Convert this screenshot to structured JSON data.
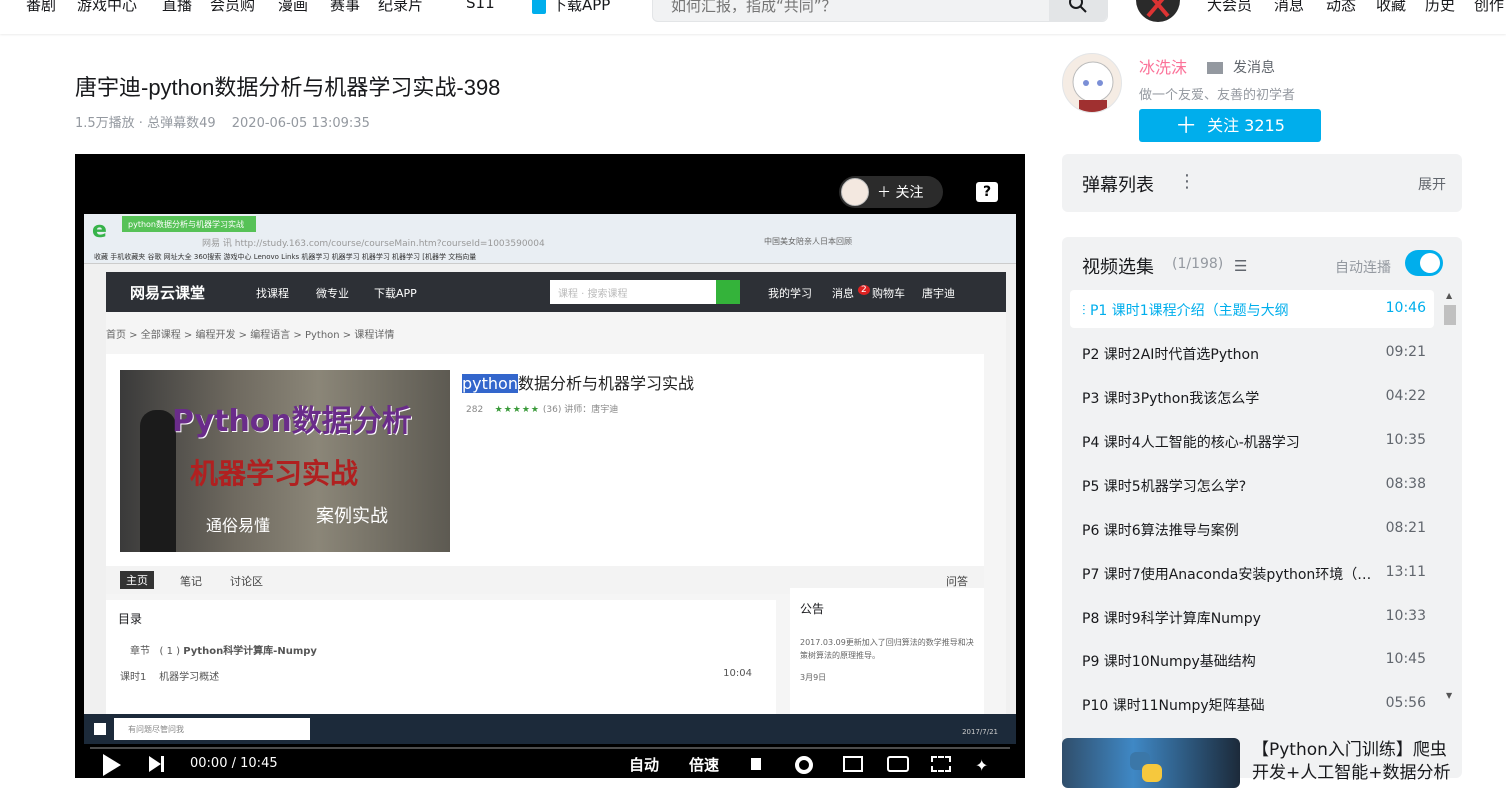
{
  "nav": {
    "items": [
      "番剧",
      "游戏中心",
      "直播",
      "会员购",
      "漫画",
      "赛事",
      "纪录片",
      "S11",
      "下载APP"
    ],
    "search_placeholder": "如何汇报，指成“共同”？",
    "right": [
      "大会员",
      "消息",
      "动态",
      "收藏",
      "历史",
      "创作"
    ]
  },
  "video": {
    "title": "唐宇迪-python数据分析与机器学习实战-398",
    "plays": "1.5万播放 · 总弹幕数49",
    "date": "2020-06-05 13:09:35"
  },
  "player": {
    "follow_label": "关注",
    "help": "?",
    "time_current": "00:00",
    "time_sep": "/",
    "time_total": "10:45",
    "auto_label": "自动",
    "speed_label": "倍速",
    "inner": {
      "tab_title": "python数据分析与机器学习实战",
      "url_prefix": "网易 讯",
      "url": "http://study.163.com/course/courseMain.htm?courseId=1003590004",
      "url_right": "中国美女陪亲人日本回顾",
      "bookmarks": "收藏 手机收藏夹 谷歌 网址大全 360搜索 游戏中心 Lenovo Links 机器学习 机器学习 机器学习 机器学习 [机器学 文档向量",
      "site_logo": "网易云课堂",
      "site_links": [
        "找课程",
        "微专业",
        "下载APP"
      ],
      "site_search": "课程 · 搜索课程",
      "site_right": [
        "我的学习",
        "消息",
        "2",
        "购物车",
        "唐宇迪"
      ],
      "breadcrumb": "首页 > 全部课程 > 编程开发 > 编程语言 > Python > 课程详情",
      "course_title_hl": "python",
      "course_title_rest": "数据分析与机器学习实战",
      "course_students": "282",
      "course_rating": "★★★★★",
      "course_reviews": "(36)",
      "course_teacher": "讲师：唐宇迪",
      "image_text": [
        "Python数据分析",
        "机器学习实战",
        "通俗易懂",
        "案例实战"
      ],
      "tabs": [
        "主页",
        "笔记",
        "讨论区"
      ],
      "tab_right": "问答",
      "toc_title": "目录",
      "toc_chapter_label": "章节",
      "toc_chapter_num": "1",
      "toc_chapter": "Python科学计算库-Numpy",
      "toc_lesson_label": "课时1",
      "toc_lesson": "机器学习概述",
      "toc_lesson_time": "10:04",
      "notice_title": "公告",
      "notice_text": "2017.03.09更新加入了回归算法的数学推导和决策树算法的原理推导。",
      "notice_date": "3月9日",
      "taskbar_search": "有问题尽管问我",
      "taskbar_time": "2017/7/21"
    }
  },
  "uploader": {
    "name": "冰洗沫",
    "message": "发消息",
    "desc": "做一个友爱、友善的初学者",
    "follow": "关注 3215"
  },
  "danmaku": {
    "title": "弹幕列表",
    "expand": "展开"
  },
  "playlist": {
    "title": "视频选集",
    "count": "(1/198)",
    "autoplay": "自动连播",
    "items": [
      {
        "label": "P1  课时1课程介绍（主题与大纲",
        "dur": "10:46"
      },
      {
        "label": "P2  课时2AI时代首选Python",
        "dur": "09:21"
      },
      {
        "label": "P3  课时3Python我该怎么学",
        "dur": "04:22"
      },
      {
        "label": "P4  课时4人工智能的核心-机器学习",
        "dur": "10:35"
      },
      {
        "label": "P5  课时5机器学习怎么学?",
        "dur": "08:38"
      },
      {
        "label": "P6  课时6算法推导与案例",
        "dur": "08:21"
      },
      {
        "label": "P7  课时7使用Anaconda安装python环境（…",
        "dur": "13:11"
      },
      {
        "label": "P8  课时9科学计算库Numpy",
        "dur": "10:33"
      },
      {
        "label": "P9  课时10Numpy基础结构",
        "dur": "10:45"
      },
      {
        "label": "P10  课时11Numpy矩阵基础",
        "dur": "05:56"
      }
    ]
  },
  "promo": {
    "line1": "【Python入门训练】爬虫",
    "line2": "开发+人工智能+数据分析"
  },
  "colors": {
    "accent": "#00aeec",
    "pink": "#fb7299"
  }
}
